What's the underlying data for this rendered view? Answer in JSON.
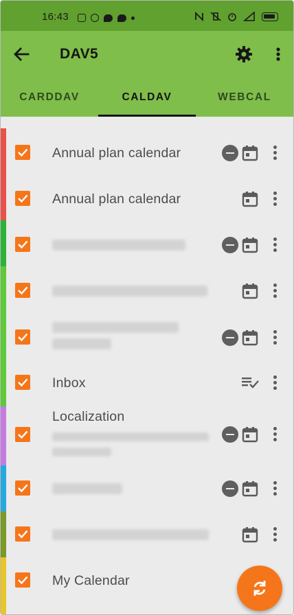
{
  "status_bar": {
    "time": "16:43"
  },
  "toolbar": {
    "title": "DAV5"
  },
  "tabs": [
    {
      "label": "CARDDAV",
      "active": false
    },
    {
      "label": "CALDAV",
      "active": true
    },
    {
      "label": "WEBCAL",
      "active": false
    }
  ],
  "calendars": [
    {
      "title": "Annual plan calendar",
      "color": "#e8524a",
      "checked": true,
      "sync_disabled": true,
      "type": "calendar"
    },
    {
      "title": "Annual plan calendar",
      "color": "#e8524a",
      "checked": true,
      "sync_disabled": false,
      "type": "calendar"
    },
    {
      "title": "",
      "color": "#2db23a",
      "checked": true,
      "sync_disabled": true,
      "type": "calendar"
    },
    {
      "title": "",
      "color": "#5ec93a",
      "checked": true,
      "sync_disabled": false,
      "type": "calendar"
    },
    {
      "title": "",
      "color": "#5ec93a",
      "checked": true,
      "sync_disabled": true,
      "type": "calendar"
    },
    {
      "title": "Inbox",
      "color": "#5ec93a",
      "checked": true,
      "sync_disabled": false,
      "type": "tasks"
    },
    {
      "title": "Localization",
      "color": "#c67be0",
      "checked": true,
      "sync_disabled": true,
      "type": "calendar"
    },
    {
      "title": "",
      "color": "#27a9e0",
      "checked": true,
      "sync_disabled": true,
      "type": "calendar"
    },
    {
      "title": "",
      "color": "#7a9a2a",
      "checked": true,
      "sync_disabled": false,
      "type": "calendar"
    },
    {
      "title": "My Calendar",
      "color": "#e8c52a",
      "checked": true,
      "sync_disabled": false,
      "type": "calendar"
    }
  ],
  "colors": {
    "status_bar": "#60a12f",
    "toolbar": "#7fbe4a",
    "accent": "#f5761a",
    "background": "#ebebeb"
  },
  "icons": {
    "back": "arrow-left-icon",
    "settings": "gear-icon",
    "overflow": "more-vert-icon",
    "sync": "sync-icon",
    "calendar": "calendar-icon",
    "tasks": "task-list-icon",
    "sync_off": "minus-circle-icon"
  }
}
